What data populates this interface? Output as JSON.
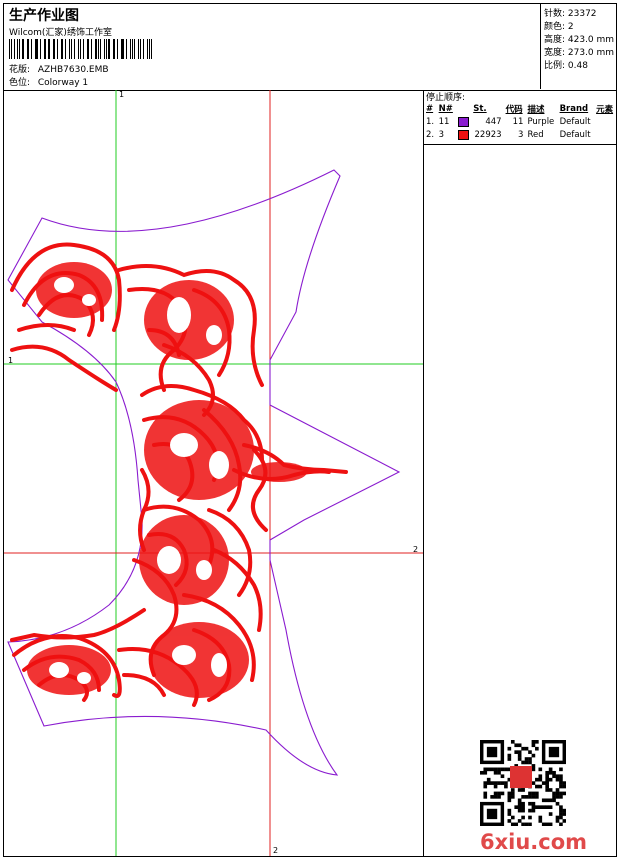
{
  "header": {
    "title": "生产作业图",
    "company": "Wilcom(汇家)绣饰工作室",
    "design_label": "花版:",
    "design_value": "AZHB7630.EMB",
    "colorway_label": "色位:",
    "colorway_value": "Colorway 1"
  },
  "stats": {
    "stitches": "针数: 23372",
    "colors": "颜色: 2",
    "height": "高度: 423.0 mm",
    "width": "宽度: 273.0 mm",
    "scale": "比例: 0.48"
  },
  "stop_sequence": {
    "caption": "停止顺序:",
    "columns": [
      "#",
      "N#",
      "St.",
      "代码",
      "描述",
      "Brand",
      "元素"
    ],
    "rows": [
      {
        "index": "1.",
        "needle": "11",
        "color": "#8a1ccf",
        "stitches": "447",
        "code": "11",
        "desc": "Purple",
        "brand": "Default",
        "element": ""
      },
      {
        "index": "2.",
        "needle": "3",
        "color": "#ee1111",
        "stitches": "22923",
        "code": "3",
        "desc": "Red",
        "brand": "Default",
        "element": ""
      }
    ]
  },
  "guides": {
    "vertical_1": "1",
    "horizontal_1": "1",
    "vertical_2": "2",
    "horizontal_2": "2"
  },
  "watermark": {
    "text": "6xiu.com",
    "seal": "印章"
  },
  "colors": {
    "purple": "#8a1ccf",
    "red": "#ee1111",
    "guide_green": "#22cc22",
    "guide_red": "#e02020"
  }
}
